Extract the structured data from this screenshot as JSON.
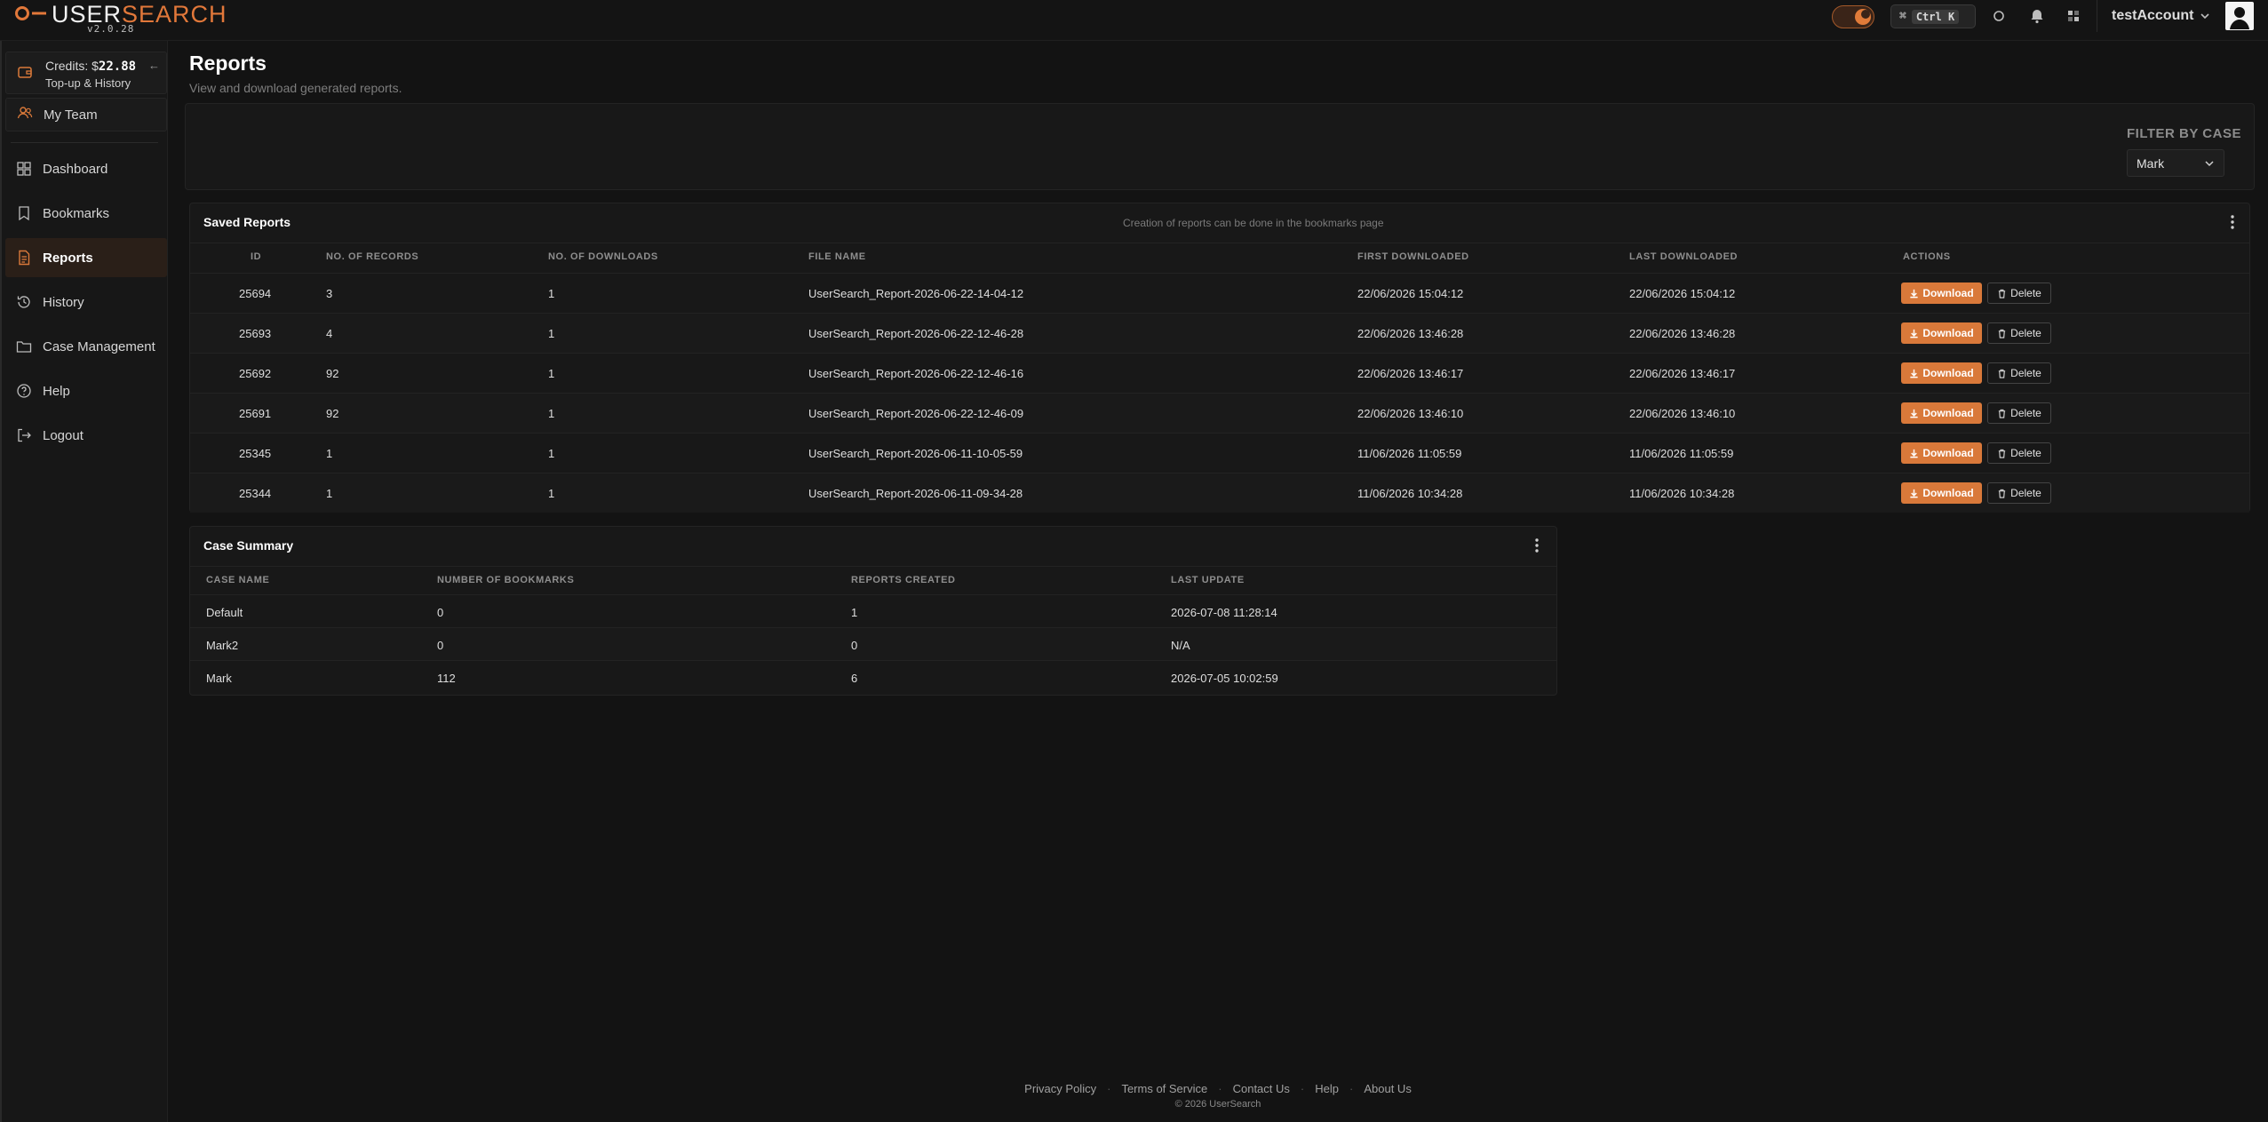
{
  "brand": {
    "name_white": "USER",
    "name_orange": "SEARCH",
    "version": "v2.0.28"
  },
  "topbar": {
    "shortcut_symbol": "⌘",
    "shortcut_key": "Ctrl K",
    "account_name": "testAccount"
  },
  "sidebar": {
    "credits_label": "Credits: $",
    "credits_amount": "22.88",
    "credits_link": "Top-up & History",
    "collapse_symbol": "←",
    "team_label": "My Team",
    "items": [
      {
        "label": "Dashboard",
        "icon": "dashboard-icon"
      },
      {
        "label": "Bookmarks",
        "icon": "bookmark-icon"
      },
      {
        "label": "Reports",
        "icon": "report-icon",
        "active": true
      },
      {
        "label": "History",
        "icon": "history-icon"
      },
      {
        "label": "Case Management",
        "icon": "folder-icon"
      },
      {
        "label": "Help",
        "icon": "help-icon"
      },
      {
        "label": "Logout",
        "icon": "logout-icon"
      }
    ]
  },
  "page": {
    "title": "Reports",
    "subtitle": "View and download generated reports."
  },
  "filter": {
    "label": "FILTER BY CASE",
    "selected": "Mark"
  },
  "saved_reports": {
    "title": "Saved Reports",
    "note": "Creation of reports can be done in the bookmarks page",
    "columns": [
      "ID",
      "NO. OF RECORDS",
      "NO. OF DOWNLOADS",
      "FILE NAME",
      "FIRST DOWNLOADED",
      "LAST DOWNLOADED",
      "ACTIONS"
    ],
    "download_label": "Download",
    "delete_label": "Delete",
    "rows": [
      {
        "id": "25694",
        "records": "3",
        "downloads": "1",
        "file": "UserSearch_Report-2026-06-22-14-04-12",
        "first": "22/06/2026 15:04:12",
        "last": "22/06/2026 15:04:12"
      },
      {
        "id": "25693",
        "records": "4",
        "downloads": "1",
        "file": "UserSearch_Report-2026-06-22-12-46-28",
        "first": "22/06/2026 13:46:28",
        "last": "22/06/2026 13:46:28"
      },
      {
        "id": "25692",
        "records": "92",
        "downloads": "1",
        "file": "UserSearch_Report-2026-06-22-12-46-16",
        "first": "22/06/2026 13:46:17",
        "last": "22/06/2026 13:46:17"
      },
      {
        "id": "25691",
        "records": "92",
        "downloads": "1",
        "file": "UserSearch_Report-2026-06-22-12-46-09",
        "first": "22/06/2026 13:46:10",
        "last": "22/06/2026 13:46:10"
      },
      {
        "id": "25345",
        "records": "1",
        "downloads": "1",
        "file": "UserSearch_Report-2026-06-11-10-05-59",
        "first": "11/06/2026 11:05:59",
        "last": "11/06/2026 11:05:59"
      },
      {
        "id": "25344",
        "records": "1",
        "downloads": "1",
        "file": "UserSearch_Report-2026-06-11-09-34-28",
        "first": "11/06/2026 10:34:28",
        "last": "11/06/2026 10:34:28"
      }
    ]
  },
  "case_summary": {
    "title": "Case Summary",
    "columns": [
      "CASE NAME",
      "NUMBER OF BOOKMARKS",
      "REPORTS CREATED",
      "LAST UPDATE"
    ],
    "rows": [
      {
        "name": "Default",
        "bookmarks": "0",
        "reports": "1",
        "updated": "2026-07-08 11:28:14"
      },
      {
        "name": "Mark2",
        "bookmarks": "0",
        "reports": "0",
        "updated": "N/A"
      },
      {
        "name": "Mark",
        "bookmarks": "112",
        "reports": "6",
        "updated": "2026-07-05 10:02:59"
      }
    ]
  },
  "footer": {
    "links": [
      "Privacy Policy",
      "Terms of Service",
      "Contact Us",
      "Help",
      "About Us"
    ],
    "separator": "·",
    "copyright": "© 2026 UserSearch"
  },
  "colors": {
    "accent": "#d9793a",
    "background": "#131313",
    "card": "#181818"
  }
}
